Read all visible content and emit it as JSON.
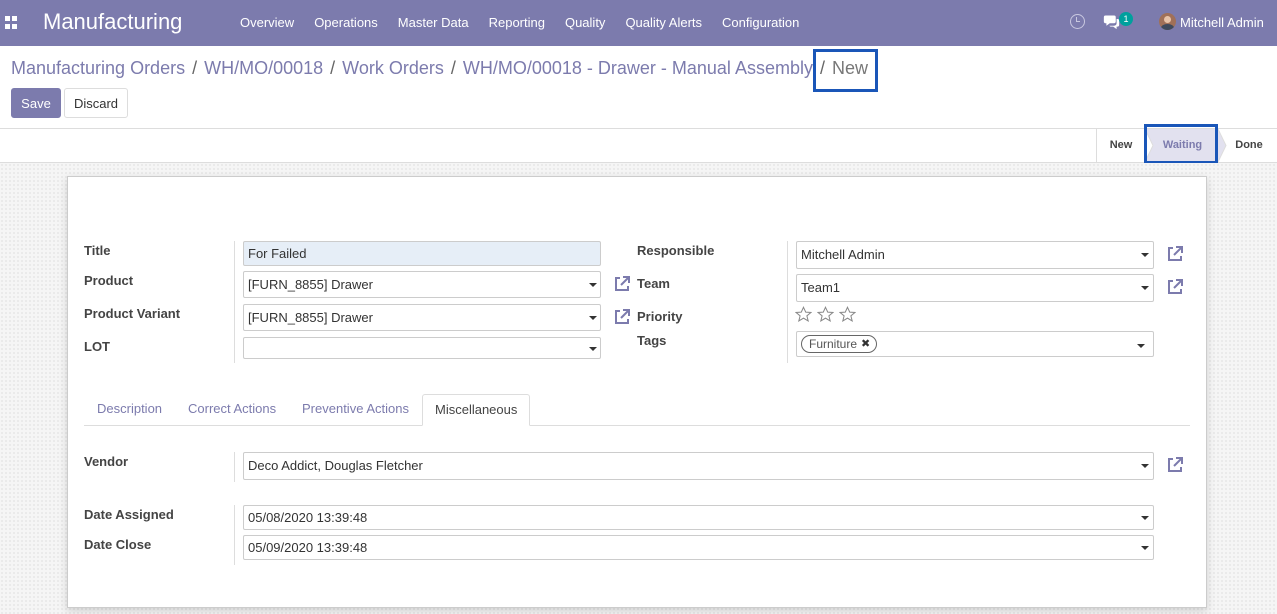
{
  "app": {
    "title": "Manufacturing"
  },
  "nav": {
    "menu": [
      "Overview",
      "Operations",
      "Master Data",
      "Reporting",
      "Quality",
      "Quality Alerts",
      "Configuration"
    ],
    "messages_count": "1",
    "user_name": "Mitchell Admin"
  },
  "breadcrumb": {
    "items": [
      "Manufacturing Orders",
      "WH/MO/00018",
      "Work Orders",
      "WH/MO/00018 - Drawer - Manual Assembly"
    ],
    "separator": "/",
    "current": "New"
  },
  "buttons": {
    "save": "Save",
    "discard": "Discard"
  },
  "statusbar": {
    "stages": [
      "New",
      "Waiting",
      "Done"
    ],
    "active": "Waiting"
  },
  "form": {
    "left": {
      "title": {
        "label": "Title",
        "value": "For Failed"
      },
      "product": {
        "label": "Product",
        "value": "[FURN_8855] Drawer"
      },
      "product_variant": {
        "label": "Product Variant",
        "value": "[FURN_8855] Drawer"
      },
      "lot": {
        "label": "LOT",
        "value": ""
      }
    },
    "right": {
      "responsible": {
        "label": "Responsible",
        "value": "Mitchell Admin"
      },
      "team": {
        "label": "Team",
        "value": "Team1"
      },
      "priority": {
        "label": "Priority",
        "value": 0,
        "max": 3
      },
      "tags": {
        "label": "Tags",
        "values": [
          "Furniture"
        ]
      }
    }
  },
  "tabs": {
    "items": [
      "Description",
      "Correct Actions",
      "Preventive Actions",
      "Miscellaneous"
    ],
    "active": "Miscellaneous"
  },
  "misc": {
    "vendor": {
      "label": "Vendor",
      "value": "Deco Addict, Douglas Fletcher"
    },
    "date_assigned": {
      "label": "Date Assigned",
      "value": "05/08/2020 13:39:48"
    },
    "date_close": {
      "label": "Date Close",
      "value": "05/09/2020 13:39:48"
    }
  },
  "colors": {
    "brand": "#7c7bad",
    "highlight": "#1a56b8",
    "required_bg": "#e6eef7"
  }
}
